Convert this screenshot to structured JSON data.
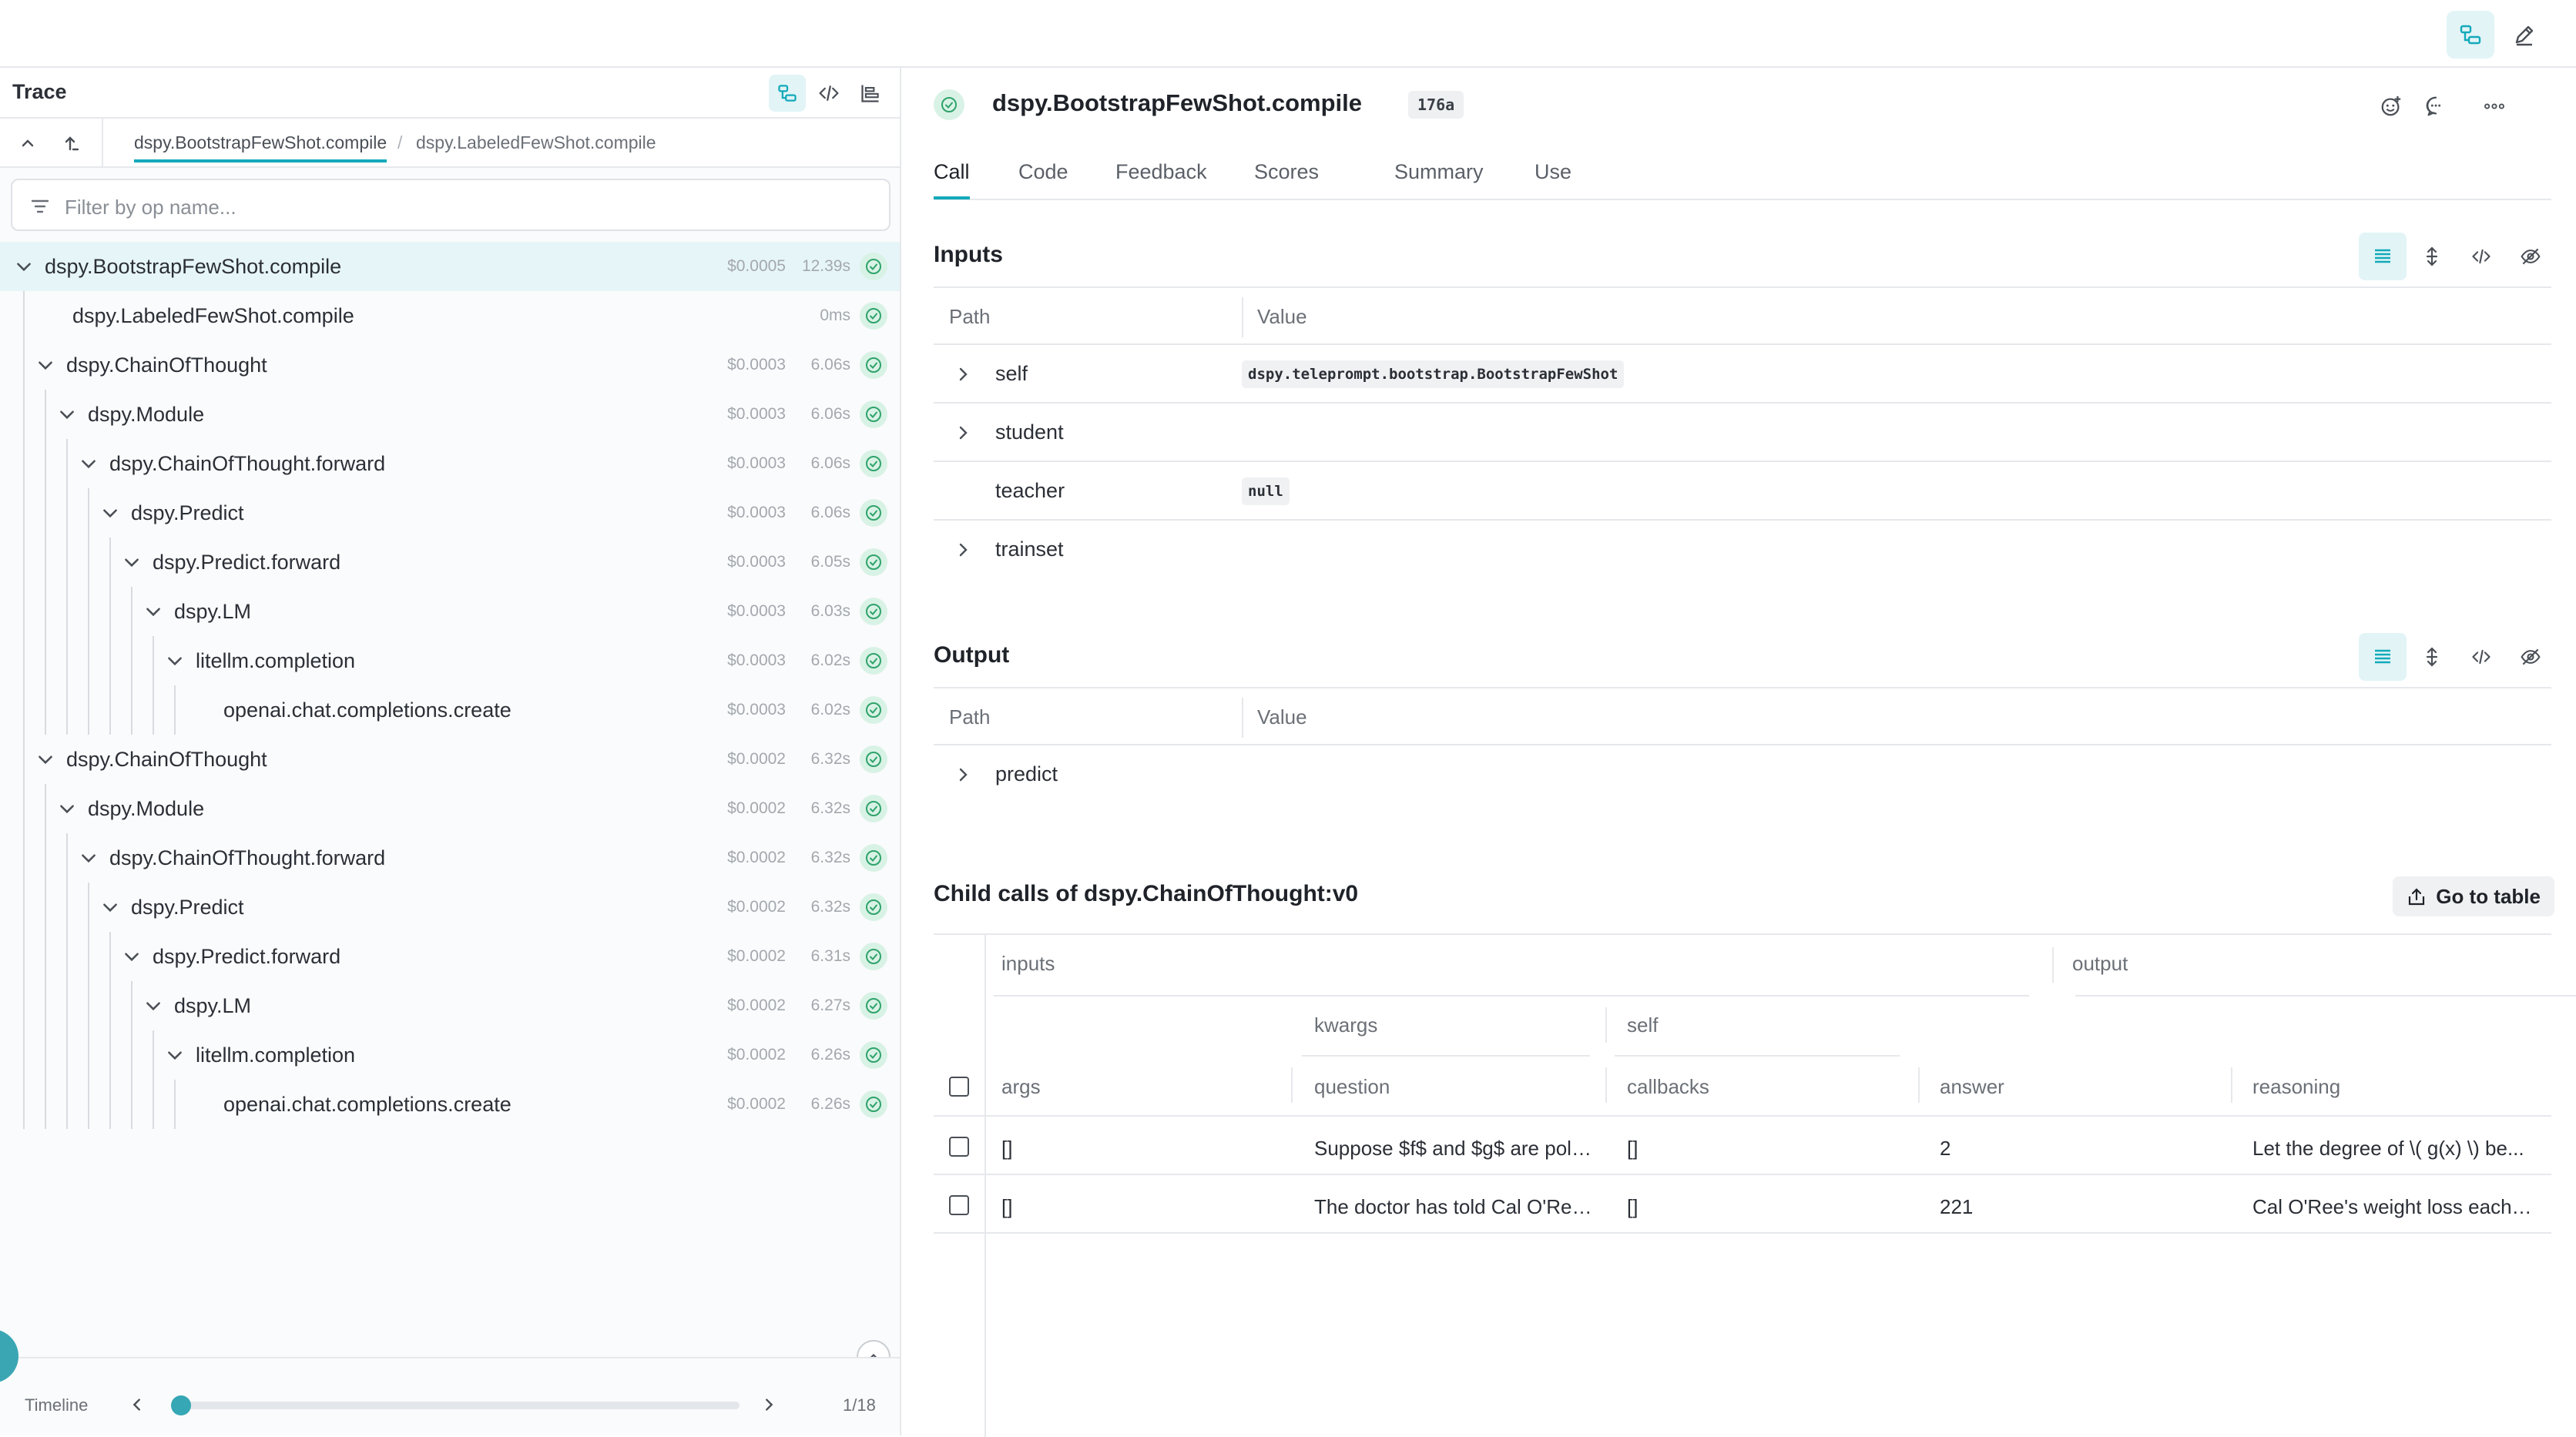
{
  "left": {
    "title": "Trace",
    "breadcrumbs": [
      "dspy.BootstrapFewShot.compile",
      "dspy.LabeledFewShot.compile"
    ],
    "breadcrumb_separator": "/",
    "filter_placeholder": "Filter by op name...",
    "tree": [
      {
        "name": "dspy.BootstrapFewShot.compile",
        "cost": "$0.0005",
        "duration": "12.39s",
        "depth": 0,
        "expanded": true,
        "selected": true
      },
      {
        "name": "dspy.LabeledFewShot.compile",
        "cost": "",
        "duration": "0ms",
        "depth": 1,
        "expanded": false
      },
      {
        "name": "dspy.ChainOfThought",
        "cost": "$0.0003",
        "duration": "6.06s",
        "depth": 1,
        "expanded": true
      },
      {
        "name": "dspy.Module",
        "cost": "$0.0003",
        "duration": "6.06s",
        "depth": 2,
        "expanded": true
      },
      {
        "name": "dspy.ChainOfThought.forward",
        "cost": "$0.0003",
        "duration": "6.06s",
        "depth": 3,
        "expanded": true
      },
      {
        "name": "dspy.Predict",
        "cost": "$0.0003",
        "duration": "6.06s",
        "depth": 4,
        "expanded": true
      },
      {
        "name": "dspy.Predict.forward",
        "cost": "$0.0003",
        "duration": "6.05s",
        "depth": 5,
        "expanded": true
      },
      {
        "name": "dspy.LM",
        "cost": "$0.0003",
        "duration": "6.03s",
        "depth": 6,
        "expanded": true
      },
      {
        "name": "litellm.completion",
        "cost": "$0.0003",
        "duration": "6.02s",
        "depth": 7,
        "expanded": true
      },
      {
        "name": "openai.chat.completions.create",
        "cost": "$0.0003",
        "duration": "6.02s",
        "depth": 8,
        "expanded": false
      },
      {
        "name": "dspy.ChainOfThought",
        "cost": "$0.0002",
        "duration": "6.32s",
        "depth": 1,
        "expanded": true
      },
      {
        "name": "dspy.Module",
        "cost": "$0.0002",
        "duration": "6.32s",
        "depth": 2,
        "expanded": true
      },
      {
        "name": "dspy.ChainOfThought.forward",
        "cost": "$0.0002",
        "duration": "6.32s",
        "depth": 3,
        "expanded": true
      },
      {
        "name": "dspy.Predict",
        "cost": "$0.0002",
        "duration": "6.32s",
        "depth": 4,
        "expanded": true
      },
      {
        "name": "dspy.Predict.forward",
        "cost": "$0.0002",
        "duration": "6.31s",
        "depth": 5,
        "expanded": true
      },
      {
        "name": "dspy.LM",
        "cost": "$0.0002",
        "duration": "6.27s",
        "depth": 6,
        "expanded": true
      },
      {
        "name": "litellm.completion",
        "cost": "$0.0002",
        "duration": "6.26s",
        "depth": 7,
        "expanded": true
      },
      {
        "name": "openai.chat.completions.create",
        "cost": "$0.0002",
        "duration": "6.26s",
        "depth": 8,
        "expanded": false
      }
    ],
    "timeline": {
      "label": "Timeline",
      "counter": "1/18",
      "position": 1,
      "total": 18
    }
  },
  "call": {
    "title": "dspy.BootstrapFewShot.compile",
    "version_badge": "176a",
    "tabs": [
      "Call",
      "Code",
      "Feedback",
      "Scores",
      "Summary",
      "Use"
    ],
    "active_tab": "Call"
  },
  "inputs": {
    "title": "Inputs",
    "col_path": "Path",
    "col_value": "Value",
    "rows": [
      {
        "name": "self",
        "value": "dspy.teleprompt.bootstrap.BootstrapFewShot",
        "expandable": true
      },
      {
        "name": "student",
        "value": "",
        "expandable": true
      },
      {
        "name": "teacher",
        "value": "null",
        "expandable": false
      },
      {
        "name": "trainset",
        "value": "",
        "expandable": true
      }
    ]
  },
  "output": {
    "title": "Output",
    "col_path": "Path",
    "col_value": "Value",
    "rows": [
      {
        "name": "predict",
        "value": "",
        "expandable": true
      }
    ]
  },
  "child_calls": {
    "title": "Child calls of dspy.ChainOfThought:v0",
    "go_to_table": "Go to table",
    "group_inputs": "inputs",
    "group_output": "output",
    "sub_kwargs": "kwargs",
    "sub_self": "self",
    "col_args": "args",
    "col_question": "question",
    "col_callbacks": "callbacks",
    "col_answer": "answer",
    "col_reasoning": "reasoning",
    "rows": [
      {
        "args": "[]",
        "question": "Suppose $f$ and $g$ are polynomials...",
        "callbacks": "[]",
        "answer": "2",
        "reasoning": "Let the degree of \\( g(x) \\) be..."
      },
      {
        "args": "[]",
        "question": "The doctor has told Cal O'Reilly...",
        "callbacks": "[]",
        "answer": "221",
        "reasoning": "Cal O'Ree's weight loss each week..."
      }
    ]
  },
  "colors": {
    "accent": "#13a9ba",
    "success": "#2fa36b",
    "selected_row": "#e6f5f8"
  }
}
